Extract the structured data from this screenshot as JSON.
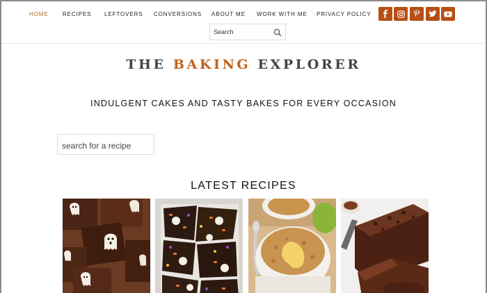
{
  "nav": {
    "items": [
      {
        "label": "HOME",
        "active": true
      },
      {
        "label": "RECIPES"
      },
      {
        "label": "LEFTOVERS"
      },
      {
        "label": "CONVERSIONS"
      },
      {
        "label": "ABOUT ME"
      },
      {
        "label": "WORK WITH ME"
      },
      {
        "label": "PRIVACY POLICY"
      }
    ],
    "social": [
      "facebook-icon",
      "instagram-icon",
      "pinterest-icon",
      "twitter-icon",
      "youtube-icon"
    ],
    "search_text": "Search"
  },
  "header": {
    "title_part1": "THE ",
    "title_accent": "BAKING",
    "title_part2": " EXPLORER",
    "tagline": "INDULGENT CAKES AND TASTY BAKES FOR EVERY OCCASION"
  },
  "recipe_search": {
    "text": "search for a recipe"
  },
  "latest": {
    "heading": "LATEST RECIPES"
  },
  "colors": {
    "accent": "#c0621b",
    "social_bg": "#b84f14",
    "active_nav": "#b5651d"
  }
}
